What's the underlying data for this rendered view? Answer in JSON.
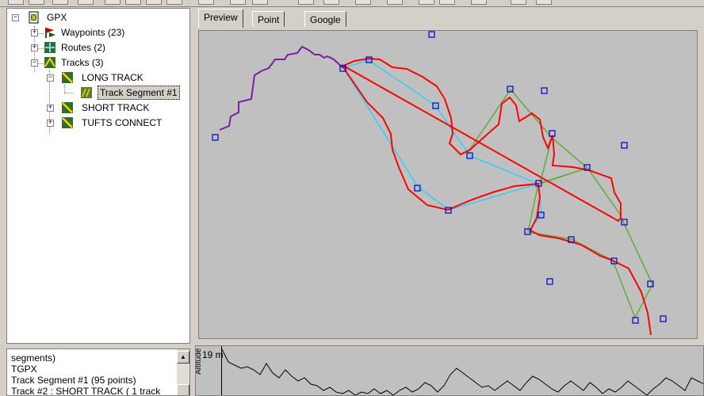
{
  "tree": {
    "root": "GPX",
    "waypoints": "Waypoints (23)",
    "routes": "Routes (2)",
    "tracks": "Tracks (3)",
    "long_track": "LONG TRACK",
    "track_segment": "Track Segment #1",
    "short_track": "SHORT TRACK",
    "tufts_connect": "TUFTS CONNECT"
  },
  "tabs": {
    "preview": "Preview",
    "point_list": "Point list",
    "google_maps": "Google Maps"
  },
  "info": {
    "lines": [
      "segments)",
      "TGPX",
      "Track Segment #1 (95 points)",
      "Track #2 : SHORT TRACK ( 1 track"
    ]
  },
  "profile": {
    "max_label": "19 m",
    "axis_label": "Altitude"
  },
  "colors": {
    "track": "#ff0000",
    "route_cyan": "#33ccff",
    "route_green": "#66aa33",
    "track_purple": "#7a1fa2",
    "waypoint": "#0000cc"
  },
  "icons": {
    "root": "gpx-file-icon",
    "waypoints": "flag-icon",
    "routes": "route-icon",
    "tracks": "track-icon"
  }
}
